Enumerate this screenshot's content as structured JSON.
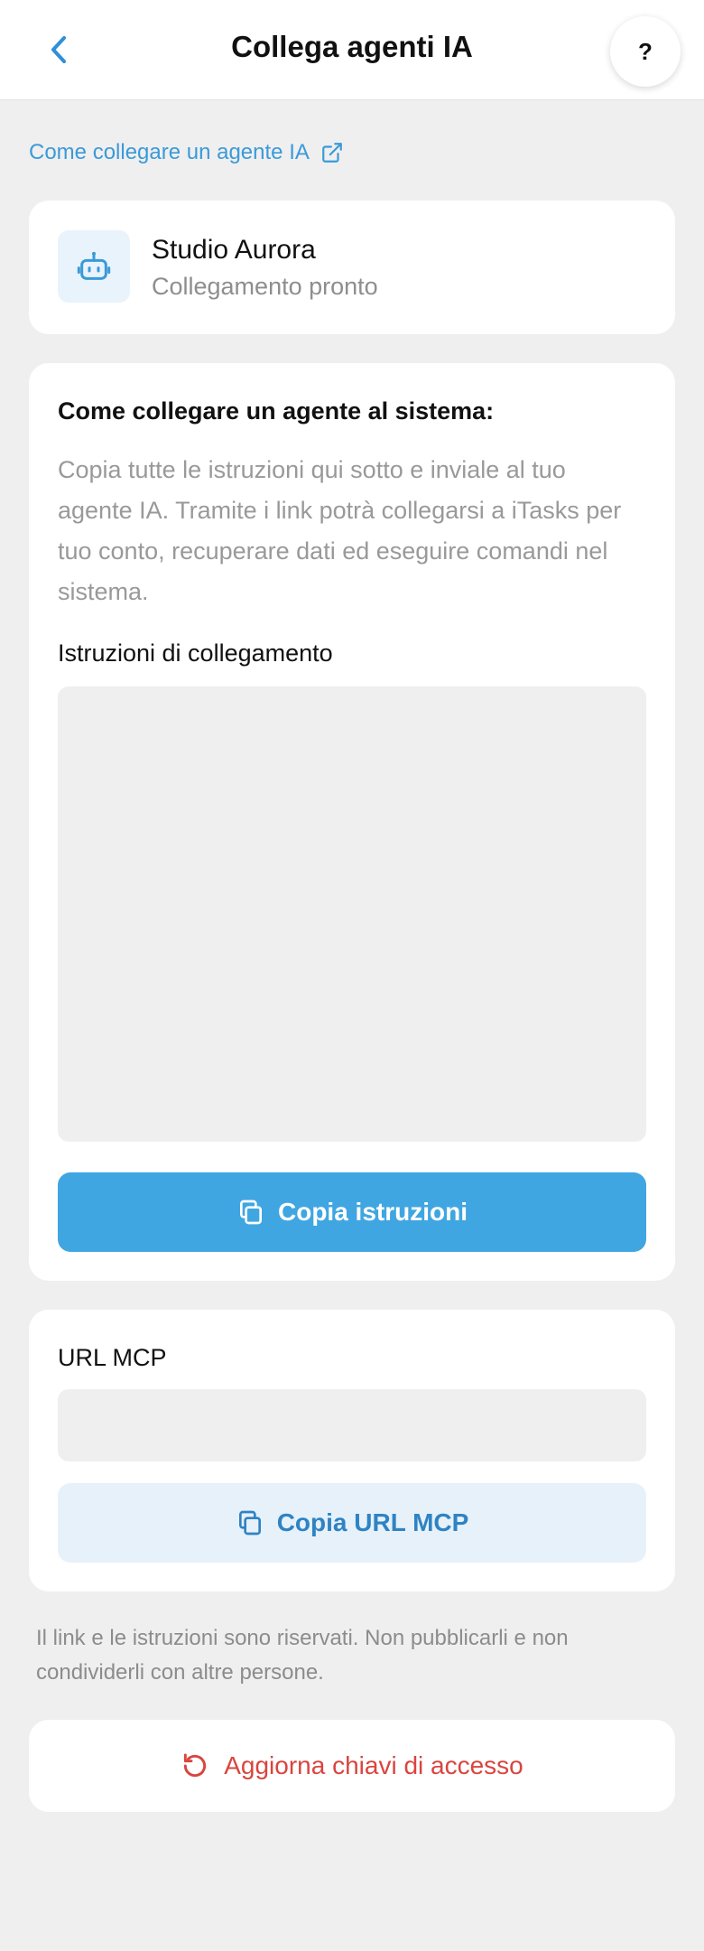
{
  "header": {
    "title": "Collega agenti IA",
    "help_label": "?"
  },
  "howto_link": {
    "label": "Come collegare un agente IA"
  },
  "agent": {
    "name": "Studio Aurora",
    "status": "Collegamento pronto"
  },
  "instructions": {
    "title": "Come collegare un agente al sistema:",
    "description": "Copia tutte le istruzioni qui sotto e inviale al tuo agente IA. Tramite i link potrà collegarsi a iTasks per tuo conto, recuperare dati ed eseguire comandi nel sistema.",
    "field_label": "Istruzioni di collegamento",
    "value": "",
    "copy_label": "Copia istruzioni"
  },
  "mcp": {
    "field_label": "URL MCP",
    "value": "",
    "copy_label": "Copia URL MCP"
  },
  "footer": {
    "note": "Il link e le istruzioni sono riservati. Non pubblicarli e non condividerli con altre persone.",
    "refresh_label": "Aggiorna chiavi di accesso"
  },
  "colors": {
    "accent": "#40a6e2",
    "link": "#3a9ad9",
    "danger": "#d9453f",
    "background": "#efefef"
  },
  "icons": {
    "back": "chevron-left-icon",
    "external": "external-link-icon",
    "agent": "robot-icon",
    "copy": "copy-icon",
    "refresh": "refresh-icon"
  }
}
